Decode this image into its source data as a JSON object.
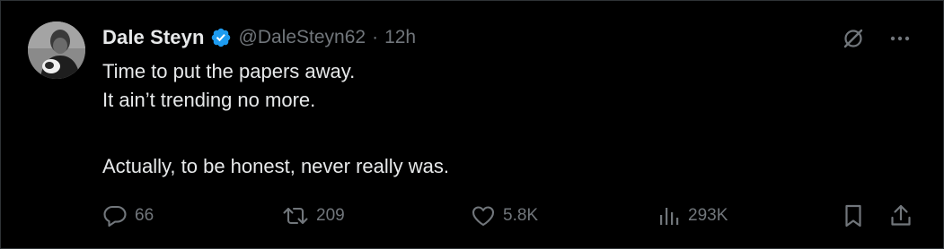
{
  "tweet": {
    "author": {
      "display_name": "Dale Steyn",
      "handle": "@DaleSteyn62",
      "verified": true
    },
    "separator": "·",
    "time": "12h",
    "body": {
      "line1": "Time to put the papers away.",
      "line2": "It ain’t trending no more.",
      "line3": "Actually, to be honest, never really was."
    },
    "stats": {
      "replies": "66",
      "reposts": "209",
      "likes": "5.8K",
      "views": "293K"
    }
  },
  "icons": {
    "verified": "verified-badge-icon",
    "grok": "grok-icon",
    "more": "more-icon",
    "reply": "reply-icon",
    "repost": "repost-icon",
    "like": "heart-icon",
    "views": "views-chart-icon",
    "bookmark": "bookmark-icon",
    "share": "share-icon"
  },
  "colors": {
    "background": "#000000",
    "text_primary": "#e7e9ea",
    "text_secondary": "#71767b",
    "verified_blue": "#1d9bf0",
    "border": "#2f3336"
  }
}
